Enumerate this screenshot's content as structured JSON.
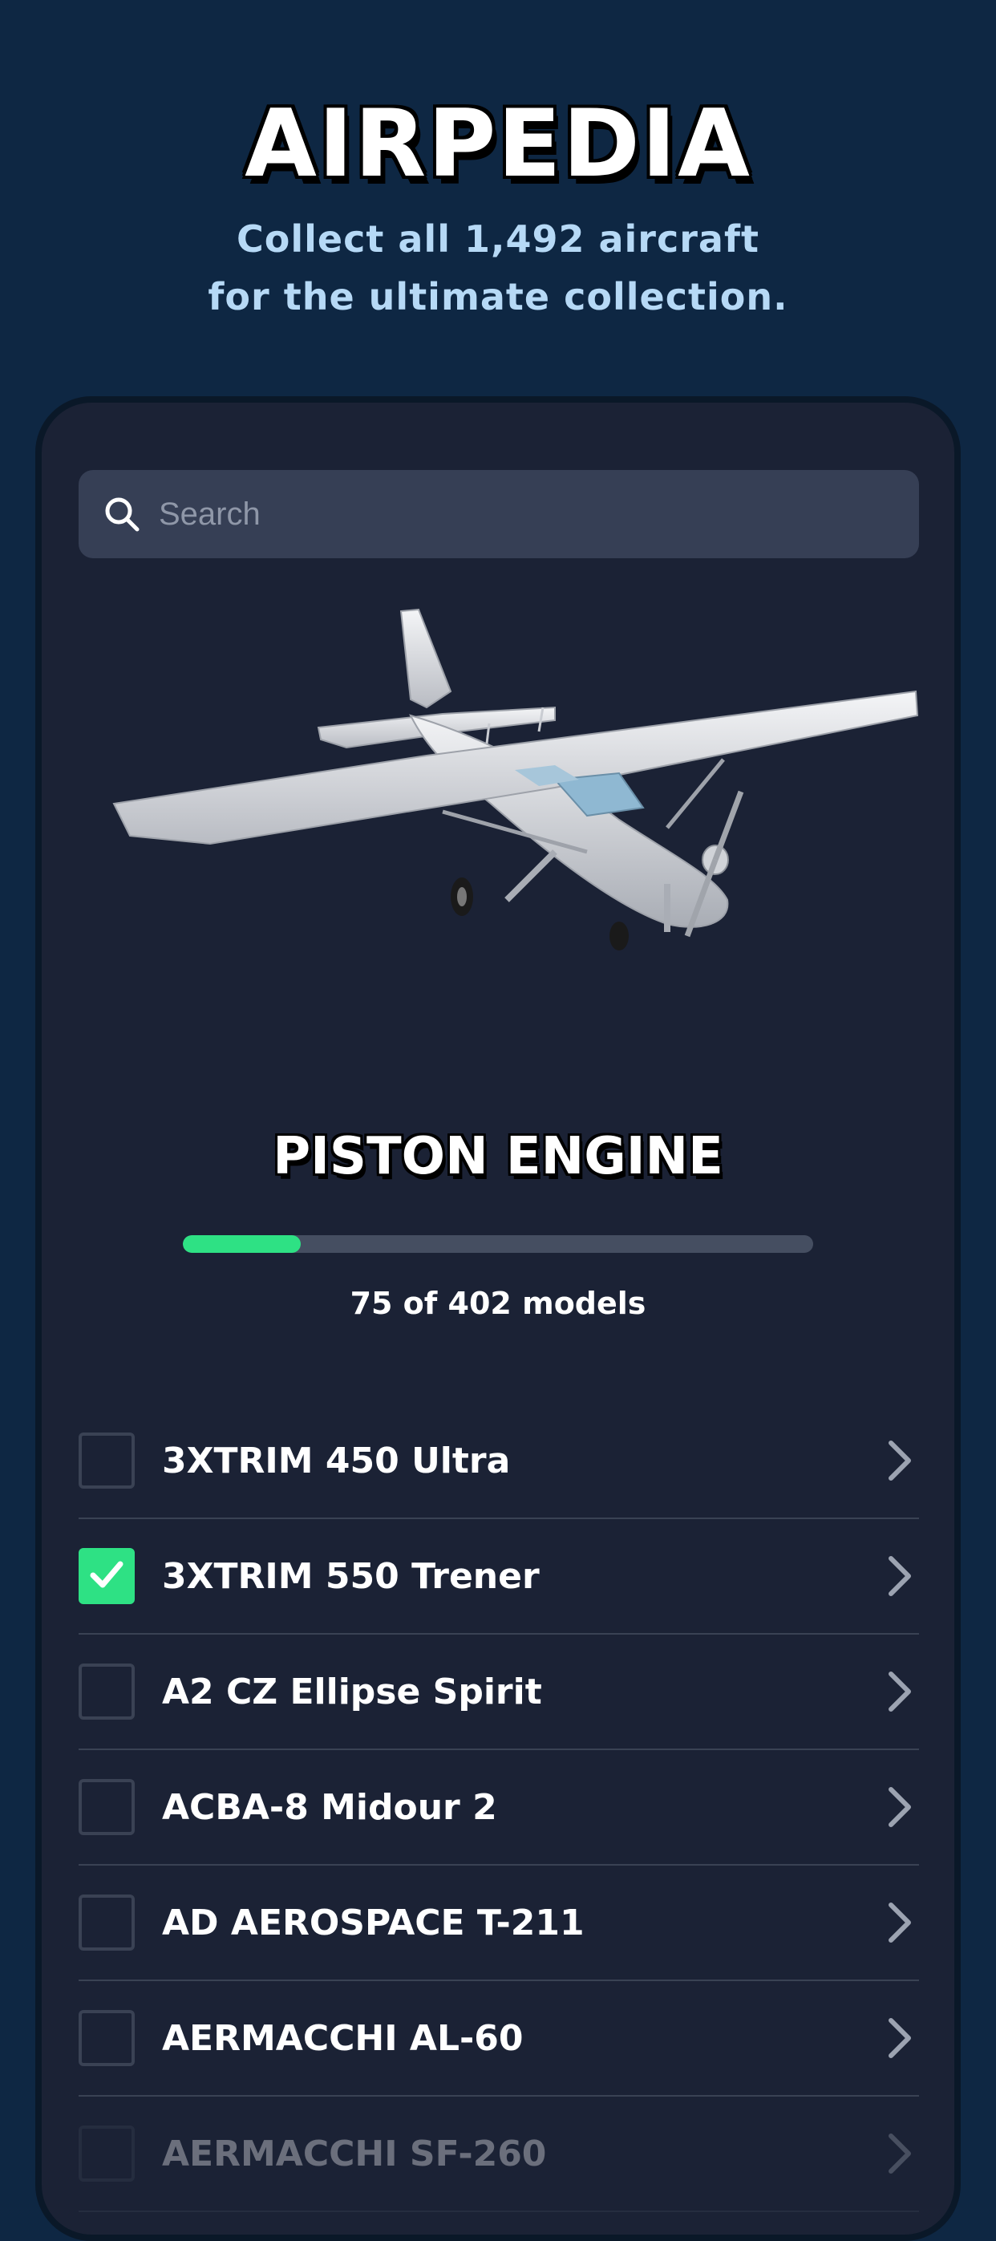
{
  "header": {
    "title": "AIRPEDIA",
    "subtitle_line1": "Collect all 1,492 aircraft",
    "subtitle_line2": "for the ultimate collection."
  },
  "search": {
    "placeholder": "Search",
    "value": ""
  },
  "category": {
    "title": "PISTON ENGINE",
    "progress_text": "75 of 402 models",
    "collected": 75,
    "total": 402
  },
  "models": [
    {
      "name": "3XTRIM 450 Ultra",
      "checked": false
    },
    {
      "name": "3XTRIM 550 Trener",
      "checked": true
    },
    {
      "name": "A2 CZ Ellipse Spirit",
      "checked": false
    },
    {
      "name": "ACBA-8 Midour 2",
      "checked": false
    },
    {
      "name": "AD AEROSPACE T-211",
      "checked": false
    },
    {
      "name": "AERMACCHI AL-60",
      "checked": false
    },
    {
      "name": "AERMACCHI SF-260",
      "checked": false
    }
  ],
  "colors": {
    "background": "#0e2743",
    "card": "#1b2235",
    "accent_green": "#2ee184",
    "subtitle": "#b6d9f6"
  },
  "icons": {
    "search": "search-icon",
    "check": "check-icon",
    "chevron": "chevron-right-icon"
  }
}
